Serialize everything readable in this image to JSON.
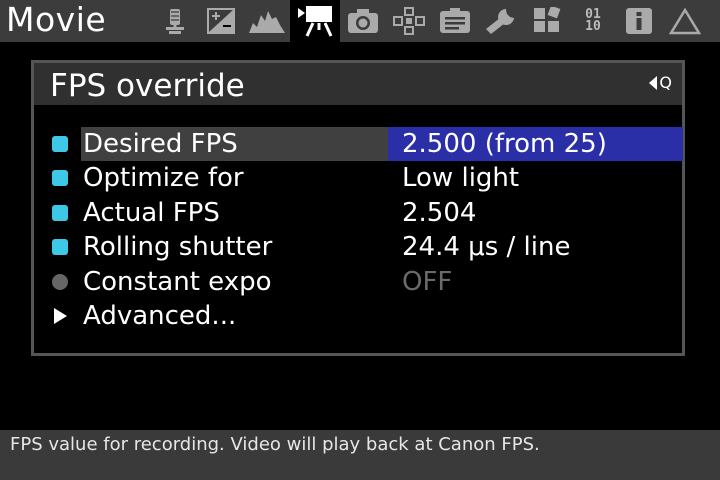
{
  "header": {
    "title": "Movie",
    "tabs": [
      {
        "icon": "microphone-icon",
        "active": false
      },
      {
        "icon": "exposure-compensation-icon",
        "active": false
      },
      {
        "icon": "histogram-icon",
        "active": false
      },
      {
        "icon": "movie-camera-icon",
        "active": true
      },
      {
        "icon": "camera-icon",
        "active": false
      },
      {
        "icon": "focus-crosshair-icon",
        "active": false
      },
      {
        "icon": "display-icon",
        "active": false
      },
      {
        "icon": "wrench-icon",
        "active": false
      },
      {
        "icon": "modules-icon",
        "active": false
      },
      {
        "icon": "debug-binary-icon",
        "active": false,
        "text_top": "01",
        "text_bottom": "10"
      },
      {
        "icon": "info-icon",
        "active": false
      },
      {
        "icon": "delta-icon",
        "active": false
      }
    ]
  },
  "panel": {
    "title": "FPS override",
    "q_indicator": "Q",
    "items": [
      {
        "label": "Desired FPS",
        "value": "2.500 (from 25)",
        "bullet": "square",
        "selected": true
      },
      {
        "label": "Optimize for",
        "value": "Low light",
        "bullet": "square",
        "selected": false
      },
      {
        "label": "Actual FPS",
        "value": "2.504",
        "bullet": "square",
        "selected": false
      },
      {
        "label": "Rolling shutter",
        "value": "24.4 μs / line",
        "bullet": "square",
        "selected": false
      },
      {
        "label": "Constant expo",
        "value": "OFF",
        "bullet": "circle",
        "selected": false,
        "disabled": true
      },
      {
        "label": "Advanced...",
        "value": "",
        "bullet": "arrow",
        "selected": false
      }
    ]
  },
  "footer": {
    "help_text": "FPS value for recording. Video will play back at Canon FPS."
  },
  "colors": {
    "bullet_active": "#3cc8e6",
    "selected_value_bg": "#2a2fa8",
    "selected_label_bg": "#404040",
    "disabled_text": "#6a6a6a"
  }
}
